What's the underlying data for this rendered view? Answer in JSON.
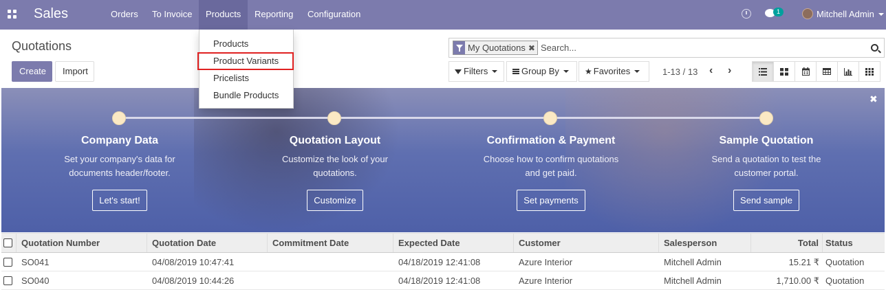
{
  "navbar": {
    "app_name": "Sales",
    "menus": [
      "Orders",
      "To Invoice",
      "Products",
      "Reporting",
      "Configuration"
    ],
    "active_menu": "Products",
    "chat_badge": "1",
    "user": "Mitchell Admin"
  },
  "products_dropdown": {
    "items": [
      "Products",
      "Product Variants",
      "Pricelists",
      "Bundle Products"
    ],
    "highlighted": "Product Variants"
  },
  "control_panel": {
    "breadcrumb": "Quotations",
    "create_label": "Create",
    "import_label": "Import",
    "facet_label": "My Quotations",
    "search_placeholder": "Search...",
    "filters_label": "Filters",
    "groupby_label": "Group By",
    "favorites_label": "Favorites",
    "pager": "1-13 / 13",
    "views": [
      "list",
      "kanban",
      "calendar",
      "pivot",
      "graph",
      "grid"
    ]
  },
  "banner": {
    "steps": [
      {
        "title": "Company Data",
        "desc_line1": "Set your company's data for",
        "desc_line2": "documents header/footer.",
        "button": "Let's start!"
      },
      {
        "title": "Quotation Layout",
        "desc_line1": "Customize the look of your",
        "desc_line2": "quotations.",
        "button": "Customize"
      },
      {
        "title": "Confirmation & Payment",
        "desc_line1": "Choose how to confirm quotations",
        "desc_line2": "and get paid.",
        "button": "Set payments"
      },
      {
        "title": "Sample Quotation",
        "desc_line1": "Send a quotation to test the",
        "desc_line2": "customer portal.",
        "button": "Send sample"
      }
    ]
  },
  "table": {
    "headers": [
      "Quotation Number",
      "Quotation Date",
      "Commitment Date",
      "Expected Date",
      "Customer",
      "Salesperson",
      "Total",
      "Status"
    ],
    "rows": [
      {
        "number": "SO041",
        "quotation_date": "04/08/2019 10:47:41",
        "commitment_date": "",
        "expected_date": "04/18/2019 12:41:08",
        "customer": "Azure Interior",
        "salesperson": "Mitchell Admin",
        "total": "15.21 ₹",
        "status": "Quotation"
      },
      {
        "number": "SO040",
        "quotation_date": "04/08/2019 10:44:26",
        "commitment_date": "",
        "expected_date": "04/18/2019 12:41:08",
        "customer": "Azure Interior",
        "salesperson": "Mitchell Admin",
        "total": "1,710.00 ₹",
        "status": "Quotation"
      }
    ]
  }
}
